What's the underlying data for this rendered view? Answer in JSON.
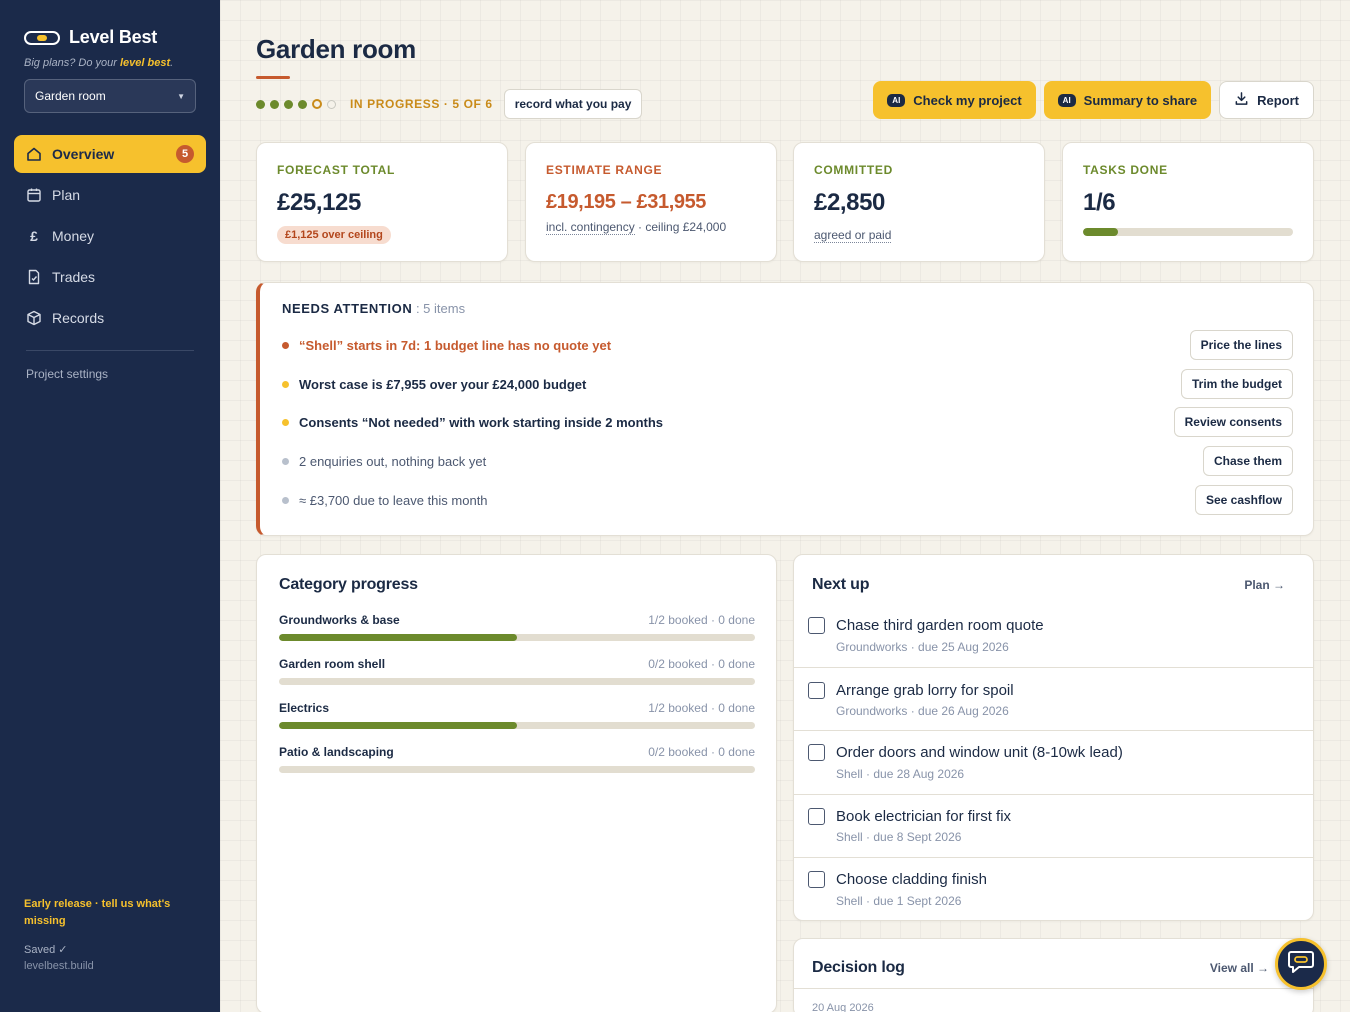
{
  "app": {
    "name": "Level Best",
    "tagline_prefix": "Big plans? Do your ",
    "tagline_highlight": "level best",
    "tagline_suffix": ".",
    "project": "Garden room",
    "accent": "#f6c12d",
    "sidebar_bg": "#1b2a4a"
  },
  "nav": {
    "items": [
      {
        "label": "Overview",
        "icon": "home-icon",
        "badge": "5"
      },
      {
        "label": "Plan",
        "icon": "calendar-icon"
      },
      {
        "label": "Money",
        "icon": "pound-icon"
      },
      {
        "label": "Trades",
        "icon": "document-icon"
      },
      {
        "label": "Records",
        "icon": "box-icon"
      }
    ],
    "settings": "Project settings"
  },
  "footer": {
    "early": "Early release · tell us what's missing",
    "saved": "Saved ✓",
    "site": "levelbest.build"
  },
  "header": {
    "title": "Garden room",
    "status": "IN PROGRESS · 5 OF 6",
    "record": "record what you pay",
    "check": "Check my project",
    "summary": "Summary to share",
    "report": "Report",
    "ai_chip": "AI"
  },
  "stats": {
    "forecast": {
      "label": "FORECAST TOTAL",
      "value": "£25,125",
      "pill": "£1,125 over ceiling"
    },
    "estimate": {
      "label": "ESTIMATE RANGE",
      "value": "£19,195 – £31,955",
      "sub_link": "incl. contingency",
      "sub_rest": " · ceiling £24,000"
    },
    "committed": {
      "label": "COMMITTED",
      "value": "£2,850",
      "sub": "agreed or paid"
    },
    "tasks": {
      "label": "TASKS DONE",
      "value": "1/6",
      "progress": 0.167
    }
  },
  "attention": {
    "title": "NEEDS ATTENTION",
    "count": " : 5 items",
    "items": [
      {
        "text": "“Shell” starts in 7d: 1 budget line has no quote yet",
        "action": "Price the lines",
        "level": "critical"
      },
      {
        "text": "Worst case is £7,955 over your £24,000 budget",
        "action": "Trim the budget",
        "level": "warning"
      },
      {
        "text": "Consents “Not needed” with work starting inside 2 months",
        "action": "Review consents",
        "level": "warning"
      },
      {
        "text": "2 enquiries out, nothing back yet",
        "action": "Chase them",
        "level": "info"
      },
      {
        "text": "≈ £3,700 due to leave this month",
        "action": "See cashflow",
        "level": "info"
      }
    ]
  },
  "categories": {
    "title": "Category progress",
    "items": [
      {
        "name": "Groundworks & base",
        "meta": "1/2 booked · 0 done",
        "progress": 0.5
      },
      {
        "name": "Garden room shell",
        "meta": "0/2 booked · 0 done",
        "progress": 0
      },
      {
        "name": "Electrics",
        "meta": "1/2 booked · 0 done",
        "progress": 0.5
      },
      {
        "name": "Patio & landscaping",
        "meta": "0/2 booked · 0 done",
        "progress": 0
      }
    ]
  },
  "next_up": {
    "title": "Next up",
    "link": "Plan →",
    "tasks": [
      {
        "title": "Chase third garden room quote",
        "meta": "Groundworks · due 25 Aug 2026"
      },
      {
        "title": "Arrange grab lorry for spoil",
        "meta": "Groundworks · due 26 Aug 2026"
      },
      {
        "title": "Order doors and window unit (8-10wk lead)",
        "meta": "Shell · due 28 Aug 2026"
      },
      {
        "title": "Book electrician for first fix",
        "meta": "Shell · due 8 Sept 2026"
      },
      {
        "title": "Choose cladding finish",
        "meta": "Shell · due 1 Sept 2026"
      }
    ]
  },
  "decision_log": {
    "title": "Decision log",
    "link": "View all →",
    "first_date": "20 Aug 2026"
  },
  "colors": {
    "critical": "#c65a2e",
    "warning": "#f6c12d",
    "info": "#b8c0cc",
    "green": "#6c8a2c"
  }
}
